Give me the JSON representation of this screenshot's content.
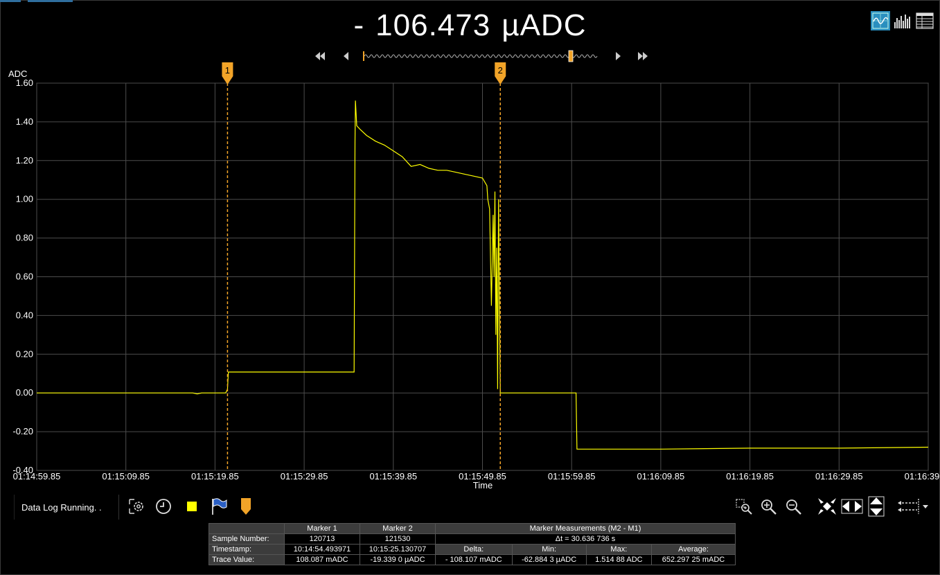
{
  "readout": {
    "sign": "-",
    "value": "106.473",
    "unit": "µADC"
  },
  "y_unit_label": "ADC",
  "x_axis_label": "Time",
  "status_text": "Data Log Running. .",
  "markers": [
    {
      "label": "1"
    },
    {
      "label": "2"
    }
  ],
  "colors": {
    "trace": "#ffff00",
    "marker": "#f2a428",
    "grid": "#4d4d4d",
    "background": "#000000",
    "active_view": "#2a8fbf"
  },
  "view_icons": [
    "waveform-view-icon",
    "histogram-view-icon",
    "table-view-icon"
  ],
  "toolbar_icons": [
    "settings-icon",
    "clock-icon",
    "color-square-icon",
    "flag-icon",
    "marker-icon",
    "zoom-box-icon",
    "zoom-in-icon",
    "zoom-out-icon",
    "fit-all-icon",
    "fit-horizontal-icon",
    "fit-vertical-icon",
    "cursor-mode-icon"
  ],
  "chart_data": {
    "type": "line",
    "ylabel": "ADC",
    "xlabel": "Time",
    "ylim": [
      -0.4,
      1.6
    ],
    "y_ticks": [
      "1.60",
      "1.40",
      "1.20",
      "1.00",
      "0.80",
      "0.60",
      "0.40",
      "0.20",
      "0.00",
      "-0.20",
      "-0.40"
    ],
    "x_ticks": [
      "01:14:59.85",
      "01:15:09.85",
      "01:15:19.85",
      "01:15:29.85",
      "01:15:39.85",
      "01:15:49.85",
      "01:15:59.85",
      "01:16:09.85",
      "01:16:19.85",
      "01:16:29.85",
      "01:16:39.85"
    ],
    "xlim_seconds_from_first_tick": [
      0,
      100
    ],
    "grid": true,
    "marker_positions_seconds": [
      21.4,
      52.0
    ],
    "series": [
      {
        "x": [
          0,
          17.5,
          18.0,
          18.5,
          21.2,
          21.4,
          21.5,
          35.6,
          35.7,
          35.75,
          35.9,
          36.3,
          37.0,
          38.0,
          39.0,
          40.0,
          41.0,
          42.0,
          43.0,
          44.0,
          45.0,
          46.0,
          47.0,
          48.0,
          49.0,
          50.0,
          50.5,
          50.6,
          50.8,
          51.0,
          51.2,
          51.3,
          51.4,
          51.5,
          51.6,
          51.7,
          51.8,
          52.0,
          52.2,
          60.5,
          60.6,
          70.0,
          80.0,
          90.0,
          100.0
        ],
        "y": [
          0.0,
          0.0,
          -0.005,
          0.0,
          0.0,
          0.02,
          0.108,
          0.108,
          1.3,
          1.51,
          1.38,
          1.36,
          1.33,
          1.3,
          1.28,
          1.25,
          1.22,
          1.17,
          1.18,
          1.16,
          1.15,
          1.15,
          1.14,
          1.13,
          1.12,
          1.11,
          1.07,
          1.0,
          0.95,
          0.45,
          0.92,
          0.6,
          1.04,
          0.3,
          0.75,
          0.02,
          1.0,
          0.0,
          0.0,
          0.0,
          -0.29,
          -0.29,
          -0.285,
          -0.285,
          -0.28
        ]
      }
    ]
  },
  "measurement_table": {
    "col_marker1": "Marker 1",
    "col_marker2": "Marker 2",
    "col_measure": "Marker Measurements (M2 - M1)",
    "row_sample": "Sample Number:",
    "row_timestamp": "Timestamp:",
    "row_trace": "Trace Value:",
    "m1_sample": "120713",
    "m2_sample": "121530",
    "delta_t": "Δt =  30.636 736 s",
    "m1_timestamp": "10:14:54.493971",
    "m2_timestamp": "10:15:25.130707",
    "h_delta": "Delta:",
    "h_min": "Min:",
    "h_max": "Max:",
    "h_average": "Average:",
    "m1_trace": "108.087  mADC",
    "m2_trace": "-19.339 0 µADC",
    "delta": "- 108.107  mADC",
    "min": "-62.884 3 µADC",
    "max": "1.514 88  ADC",
    "average": "652.297 25 mADC"
  }
}
